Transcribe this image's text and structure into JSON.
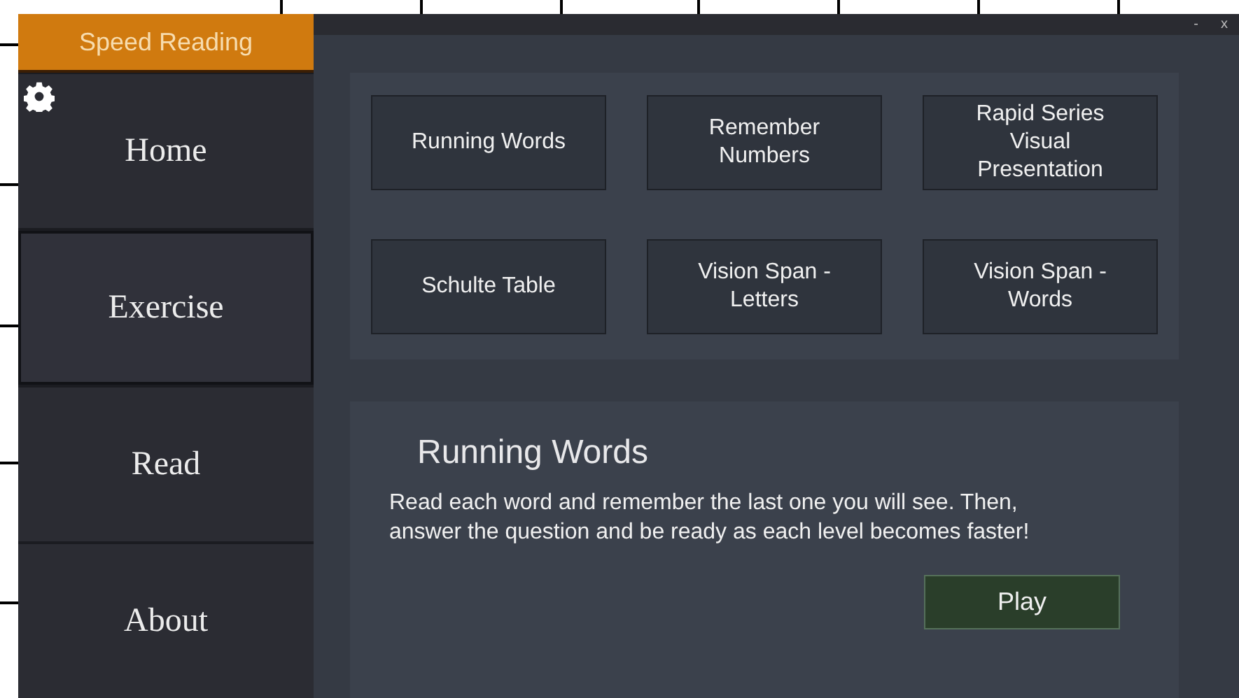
{
  "app_title": "Speed Reading",
  "window_controls": [
    "-",
    "x"
  ],
  "nav": [
    {
      "label": "Home",
      "selected": false
    },
    {
      "label": "Exercise",
      "selected": true
    },
    {
      "label": "Read",
      "selected": false
    },
    {
      "label": "About",
      "selected": false
    }
  ],
  "exercises": [
    "Running Words",
    "Remember Numbers",
    "Rapid Series Visual Presentation",
    "Schulte Table",
    "Vision Span - Letters",
    "Vision Span - Words"
  ],
  "description": {
    "title": "Running Words",
    "text": "Read each word and remember the last one you will see. Then, answer the question and be ready as each level becomes faster!",
    "button": "Play"
  }
}
